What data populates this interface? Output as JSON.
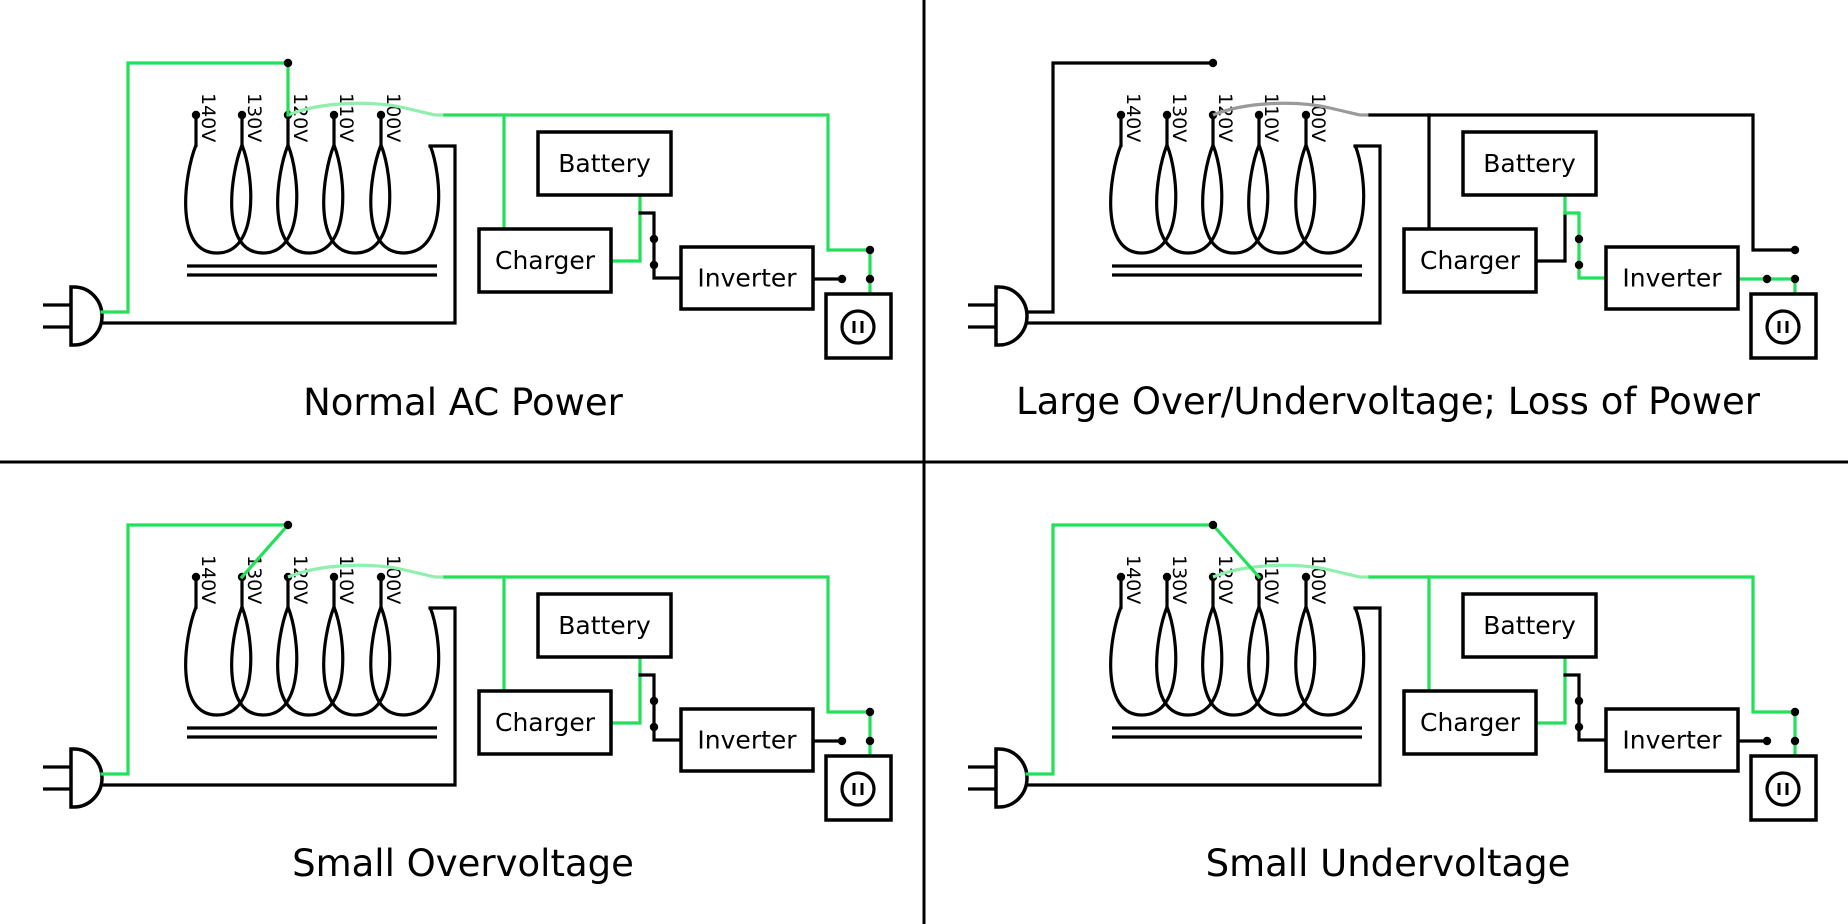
{
  "colors": {
    "active": "#22e05a",
    "inactive": "#000000",
    "curve_active": "#8ef0ac",
    "curve_inactive": "#9a9a9a"
  },
  "labels": {
    "battery": "Battery",
    "charger": "Charger",
    "inverter": "Inverter",
    "taps": [
      "140V",
      "130V",
      "120V",
      "110V",
      "100V"
    ]
  },
  "panels": [
    {
      "title": "Normal AC Power",
      "selected_tap": "120V",
      "ac_present": true,
      "charger_active": true,
      "inverter_active": false,
      "output_source": "line"
    },
    {
      "title": "Large Over/Undervoltage; Loss of Power",
      "selected_tap": null,
      "ac_present": false,
      "charger_active": false,
      "inverter_active": true,
      "output_source": "inverter"
    },
    {
      "title": "Small Overvoltage",
      "selected_tap": "130V",
      "ac_present": true,
      "charger_active": true,
      "inverter_active": false,
      "output_source": "line"
    },
    {
      "title": "Small Undervoltage",
      "selected_tap": "110V",
      "ac_present": true,
      "charger_active": true,
      "inverter_active": false,
      "output_source": "line"
    }
  ]
}
